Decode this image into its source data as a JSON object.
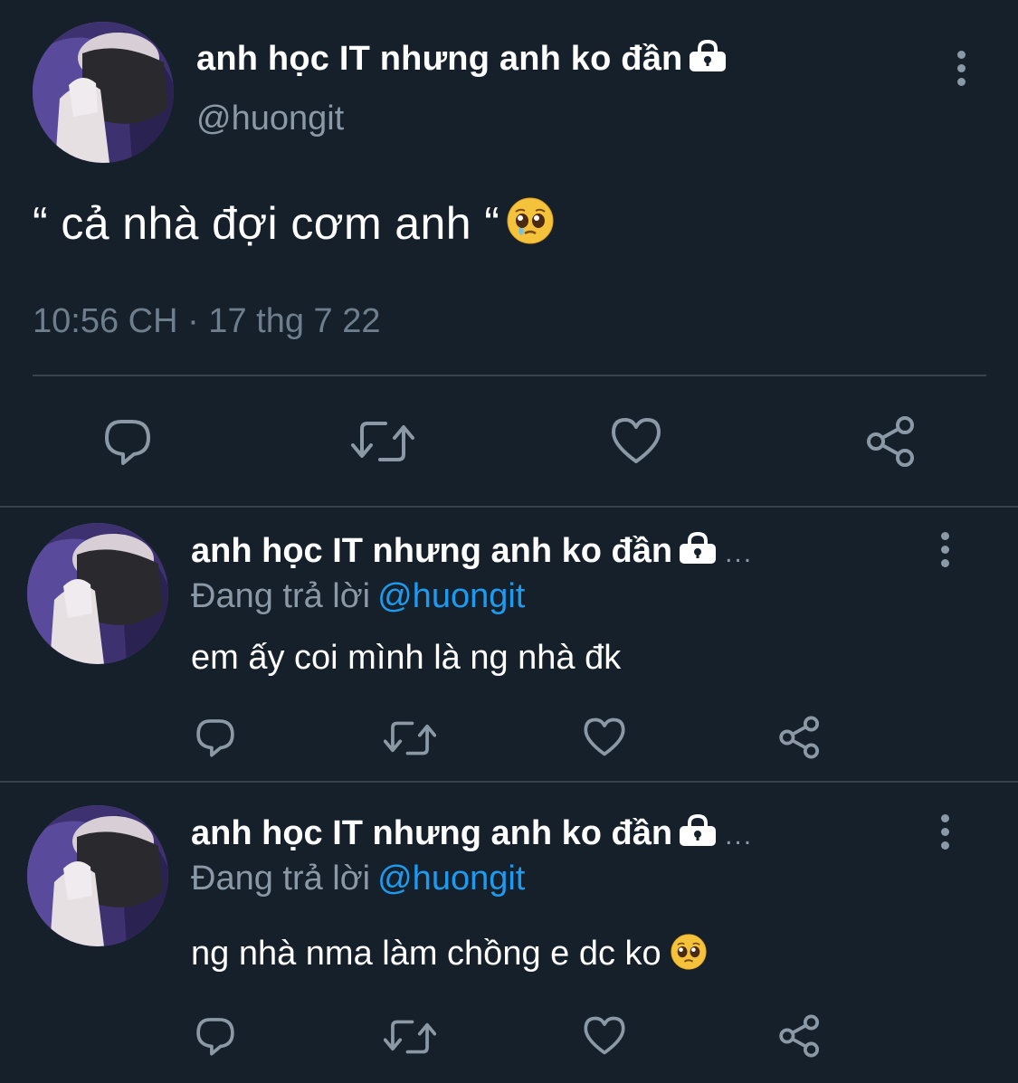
{
  "main_tweet": {
    "display_name": "anh học IT nhưng anh ko đần",
    "handle": "@huongit",
    "text": "“ cả nhà đợi cơm anh “",
    "emoji": "pleading-face-with-tear",
    "timestamp": "10:56 CH · 17 thg 7 22",
    "actions": [
      "reply-icon",
      "retweet-icon",
      "like-icon",
      "share-icon"
    ]
  },
  "replies": [
    {
      "display_name": "anh học IT nhưng anh ko đần",
      "ellipsis": "...",
      "replying_label": "Đang trả lời",
      "replying_to": "@huongit",
      "text": "em ấy coi mình là ng nhà đk",
      "actions": [
        "reply-icon",
        "retweet-icon",
        "like-icon",
        "share-icon"
      ]
    },
    {
      "display_name": "anh học IT nhưng anh ko đần",
      "ellipsis": "...",
      "replying_label": "Đang trả lời",
      "replying_to": "@huongit",
      "text": "ng nhà nma làm chồng e dc ko",
      "emoji": "pleading-face",
      "actions": [
        "reply-icon",
        "retweet-icon",
        "like-icon",
        "share-icon"
      ]
    }
  ],
  "colors": {
    "background": "#15202b",
    "text_primary": "#ffffff",
    "text_secondary": "#8b98a5",
    "accent": "#1d9bf0",
    "divider": "#38444d"
  }
}
